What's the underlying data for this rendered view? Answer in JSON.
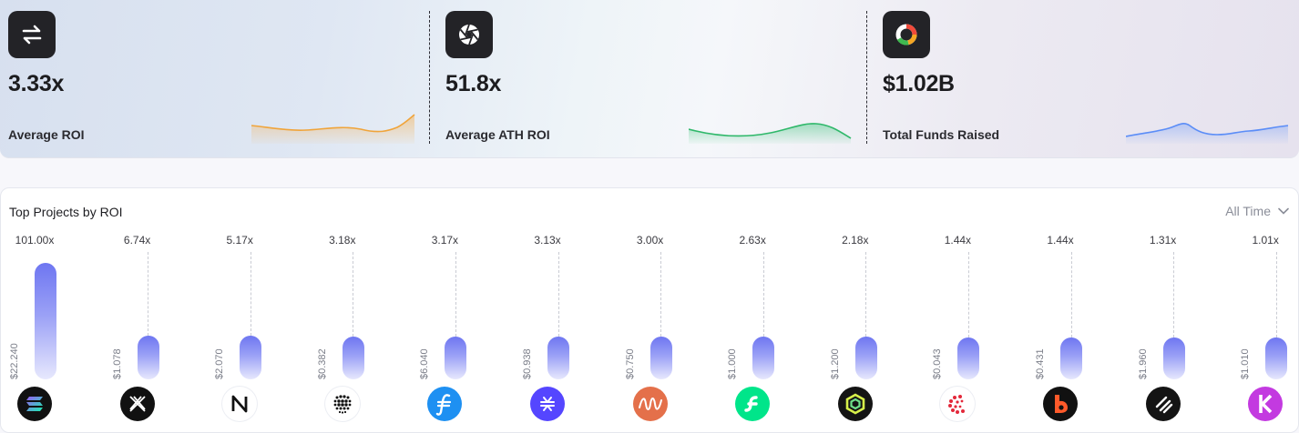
{
  "stats": [
    {
      "value": "3.33x",
      "label": "Average ROI",
      "icon": "swap-arrows-icon",
      "spark_color": "#f0a43a"
    },
    {
      "value": "51.8x",
      "label": "Average ATH ROI",
      "icon": "aperture-icon",
      "spark_color": "#2fb86a"
    },
    {
      "value": "$1.02B",
      "label": "Total Funds Raised",
      "icon": "ring-chart-icon",
      "spark_color": "#5b8df7"
    }
  ],
  "panel": {
    "title": "Top Projects by ROI",
    "range": "All Time"
  },
  "chart_data": {
    "type": "bar",
    "title": "Top Projects by ROI",
    "categories": [
      "solana",
      "immutable-x",
      "near",
      "dots",
      "filecoin",
      "stacks",
      "harmony",
      "flow",
      "polygon-ring",
      "celo-c",
      "bitdao-b",
      "slashes",
      "kadena-k"
    ],
    "series": [
      {
        "values": [
          101.0,
          6.74,
          5.17,
          3.18,
          3.17,
          3.13,
          3.0,
          2.63,
          2.18,
          1.44,
          1.44,
          1.31,
          1.01
        ]
      }
    ],
    "roi_labels": [
      "101.00x",
      "6.74x",
      "5.17x",
      "3.18x",
      "3.17x",
      "3.13x",
      "3.00x",
      "2.63x",
      "2.18x",
      "1.44x",
      "1.44x",
      "1.31x",
      "1.01x"
    ],
    "price_labels": [
      "$22.240",
      "$1.078",
      "$2.070",
      "$0.382",
      "$6.040",
      "$0.938",
      "$0.750",
      "$1.000",
      "$1.200",
      "$0.043",
      "$0.431",
      "$1.960",
      "$1.010"
    ]
  },
  "projects": [
    {
      "icon": "solana-logo-icon",
      "bg": "#111111"
    },
    {
      "icon": "immutable-x-logo-icon",
      "bg": "#111111"
    },
    {
      "icon": "near-logo-icon",
      "bg": "#ffffff"
    },
    {
      "icon": "dots-logo-icon",
      "bg": "#ffffff"
    },
    {
      "icon": "filecoin-logo-icon",
      "bg": "#1e90f2"
    },
    {
      "icon": "stacks-logo-icon",
      "bg": "#5546ff"
    },
    {
      "icon": "wave-logo-icon",
      "bg": "#e4704a"
    },
    {
      "icon": "flow-logo-icon",
      "bg": "#00e58a"
    },
    {
      "icon": "hexagon-ring-logo-icon",
      "bg": "#141414"
    },
    {
      "icon": "c-dots-logo-icon",
      "bg": "#ffffff"
    },
    {
      "icon": "b-logo-icon",
      "bg": "#111111"
    },
    {
      "icon": "slashes-logo-icon",
      "bg": "#141414"
    },
    {
      "icon": "k-logo-icon",
      "bg": "#c33ae0"
    }
  ]
}
